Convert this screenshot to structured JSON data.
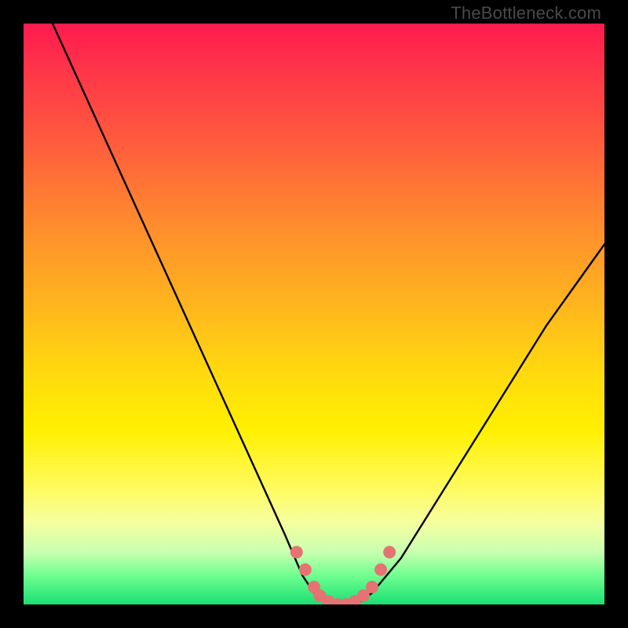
{
  "watermark": "TheBottleneck.com",
  "chart_data": {
    "type": "line",
    "title": "",
    "xlabel": "",
    "ylabel": "",
    "xlim": [
      0,
      100
    ],
    "ylim": [
      0,
      100
    ],
    "series": [
      {
        "name": "bottleneck-curve",
        "x": [
          5,
          10,
          15,
          20,
          25,
          30,
          35,
          40,
          45,
          48,
          50,
          52,
          54,
          56,
          58,
          60,
          65,
          70,
          75,
          80,
          85,
          90,
          95,
          100
        ],
        "y": [
          100,
          89,
          78,
          67,
          56,
          45,
          34,
          23,
          12,
          5,
          2,
          0.5,
          0,
          0,
          0.5,
          2,
          8,
          16,
          24,
          32,
          40,
          48,
          55,
          62
        ]
      }
    ],
    "markers": {
      "name": "highlight-points",
      "color": "#e57373",
      "points": [
        {
          "x": 47,
          "y": 9
        },
        {
          "x": 48.5,
          "y": 6
        },
        {
          "x": 50,
          "y": 3
        },
        {
          "x": 51,
          "y": 1.5
        },
        {
          "x": 52.5,
          "y": 0.5
        },
        {
          "x": 54,
          "y": 0
        },
        {
          "x": 55.5,
          "y": 0
        },
        {
          "x": 57,
          "y": 0.5
        },
        {
          "x": 58.5,
          "y": 1.5
        },
        {
          "x": 60,
          "y": 3
        },
        {
          "x": 61.5,
          "y": 6
        },
        {
          "x": 63,
          "y": 9
        }
      ]
    },
    "colors": {
      "curve": "#000000",
      "marker": "#e57373",
      "background_top": "#ff1a4e",
      "background_bottom": "#1adf72",
      "frame": "#000000"
    }
  }
}
